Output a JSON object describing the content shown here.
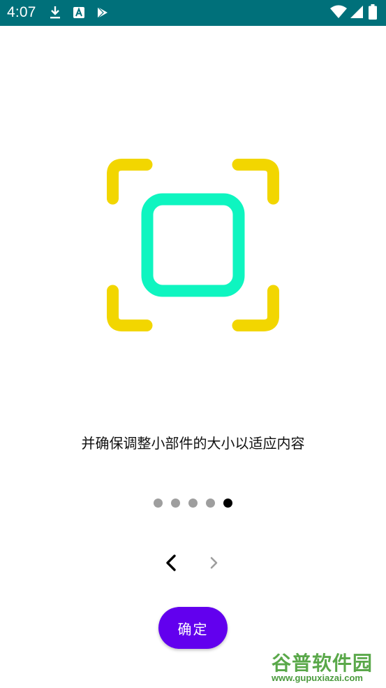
{
  "status_bar": {
    "time": "4:07",
    "background_color": "#00707a",
    "left_icons": [
      "download-icon",
      "font-app-icon",
      "play-store-icon"
    ],
    "right_icons": [
      "wifi-icon",
      "cellular-signal-icon",
      "battery-icon"
    ]
  },
  "illustration": {
    "icon": "resize-frame-icon",
    "corner_color": "#f2d600",
    "square_color": "#0ef5c0"
  },
  "instruction_text": "并确保调整小部件的大小以适应内容",
  "page_indicator": {
    "total": 5,
    "active_index": 4,
    "inactive_color": "#9e9e9e",
    "active_color": "#000000"
  },
  "navigation": {
    "prev_icon": "chevron-left-icon",
    "next_icon": "chevron-right-icon",
    "next_disabled": true
  },
  "confirm_button": {
    "label": "确定",
    "color": "#6200ee"
  },
  "watermark": {
    "title": "谷普软件园",
    "url": "www.gupuxiazai.com"
  }
}
